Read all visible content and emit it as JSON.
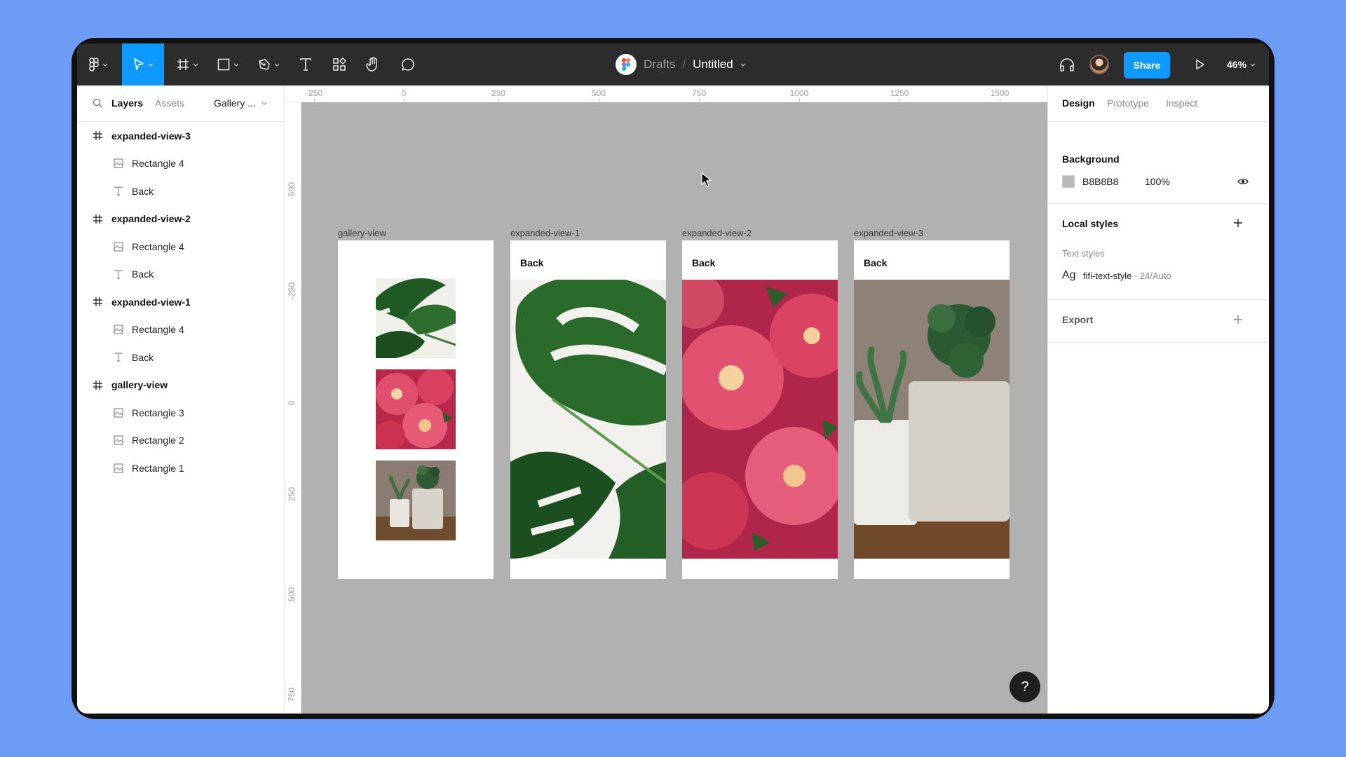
{
  "toolbar": {
    "breadcrumb_root": "Drafts",
    "breadcrumb_sep": "/",
    "file_name": "Untitled",
    "share_label": "Share",
    "zoom": "46%",
    "accent": "#0d99ff"
  },
  "left_panel": {
    "tab_layers": "Layers",
    "tab_assets": "Assets",
    "page_name": "Gallery ...",
    "layers": [
      {
        "name": "expanded-view-3",
        "type": "frame"
      },
      {
        "name": "Rectangle 4",
        "type": "image"
      },
      {
        "name": "Back",
        "type": "text"
      },
      {
        "name": "expanded-view-2",
        "type": "frame"
      },
      {
        "name": "Rectangle 4",
        "type": "image"
      },
      {
        "name": "Back",
        "type": "text"
      },
      {
        "name": "expanded-view-1",
        "type": "frame"
      },
      {
        "name": "Rectangle 4",
        "type": "image"
      },
      {
        "name": "Back",
        "type": "text"
      },
      {
        "name": "gallery-view",
        "type": "frame"
      },
      {
        "name": "Rectangle 3",
        "type": "image"
      },
      {
        "name": "Rectangle 2",
        "type": "image"
      },
      {
        "name": "Rectangle 1",
        "type": "image"
      }
    ]
  },
  "rulers": {
    "top": [
      "-250",
      "0",
      "250",
      "500",
      "750",
      "1000",
      "1250",
      "1500"
    ],
    "left": [
      "-500",
      "-250",
      "0",
      "250",
      "500",
      "750"
    ]
  },
  "canvas": {
    "background": "#b1b1b1",
    "frames": {
      "gallery": "gallery-view",
      "ev1": "expanded-view-1",
      "ev2": "expanded-view-2",
      "ev3": "expanded-view-3"
    },
    "back_label": "Back"
  },
  "right_panel": {
    "tab_design": "Design",
    "tab_prototype": "Prototype",
    "tab_inspect": "Inspect",
    "background_title": "Background",
    "background_hex": "B8B8B8",
    "background_opacity": "100%",
    "local_styles_title": "Local styles",
    "text_styles_label": "Text styles",
    "text_style_glyph": "Ag",
    "text_style_name": "fifi-text-style",
    "text_style_meta": " · 24/Auto",
    "export_title": "Export"
  },
  "help_label": "?"
}
